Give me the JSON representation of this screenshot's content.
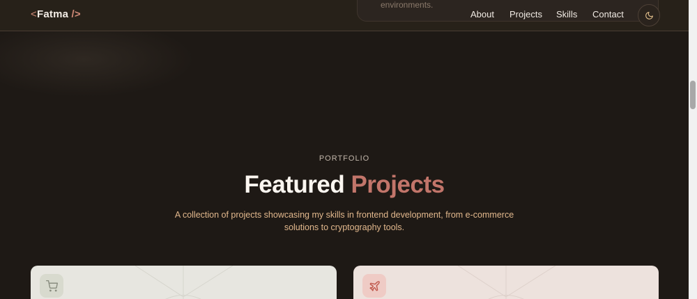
{
  "navbar": {
    "logo_open": "<",
    "logo_name": "Fatma",
    "logo_close": "/>",
    "links": [
      "About",
      "Projects",
      "Skills",
      "Contact"
    ],
    "theme_icon": "moon-icon"
  },
  "popover": {
    "text": "environments."
  },
  "section": {
    "eyebrow": "PORTFOLIO",
    "title_main": "Featured",
    "title_accent": "Projects",
    "description": "A collection of projects showcasing my skills in frontend development, from e-commerce solutions to cryptography tools."
  },
  "cards": [
    {
      "icon": "shopping-cart-icon"
    },
    {
      "icon": "plane-icon"
    }
  ],
  "colors": {
    "background": "#1e1915",
    "accent": "#c2756a",
    "subtitle": "#e2b88d"
  }
}
